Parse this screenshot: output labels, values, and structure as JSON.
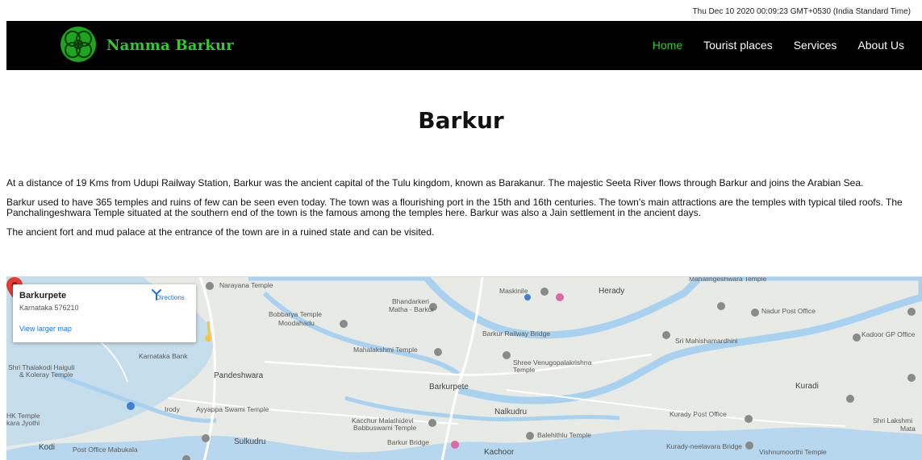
{
  "header": {
    "datetime": "Thu Dec 10 2020 00:09:23 GMT+0530 (India Standard Time)"
  },
  "navbar": {
    "brand": "Namma Barkur",
    "links": [
      {
        "label": "Home",
        "active": true
      },
      {
        "label": "Tourist places",
        "active": false
      },
      {
        "label": "Services",
        "active": false
      },
      {
        "label": "About Us",
        "active": false
      }
    ],
    "accent_color": "#2ecc2e"
  },
  "main": {
    "title": "Barkur",
    "paragraphs": [
      "At a distance of 19 Kms from Udupi Railway Station, Barkur was the ancient capital of the Tulu kingdom, known as Barakanur. The majestic Seeta River flows through Barkur and joins the Arabian Sea.",
      "Barkur used to have 365 temples and ruins of few can be seen even today. The town was a flourishing port in the 15th and 16th centuries. The town's main attractions are the temples with typical tiled roofs. The Panchalingeshwara Temple situated at the southern end of the town is the famous among the temples here. Barkur was also a Jain settlement in the ancient days.",
      "The ancient fort and mud palace at the entrance of the town are in a ruined state and can be visited."
    ]
  },
  "map": {
    "card": {
      "title": "Barkurpete",
      "address": "Karnataka 576210",
      "directions": "Directions",
      "larger_map": "View larger map"
    },
    "labels": {
      "narayana": "Narayana Temple",
      "bobbarya": "Bobbarya Temple",
      "moodahadu": "Moodahadu",
      "bhandarkeri": "Bhandarkeri",
      "matha": "Matha - Barkur",
      "maskinile": "Maskinile",
      "herady": "Herady",
      "nadur": "Nadur Post Office",
      "kadoor": "Kadoor GP Office",
      "railway": "Barkur Railway Bridge",
      "mahalakshmi": "Mahalakshmi Temple",
      "shree": "Shree Venugopalakrishna",
      "temple": "Temple",
      "sri_mahisha": "Sri Mahishamardhini",
      "kurkadi": "Kuradi",
      "karnataka_bank": "Karnataka Bank",
      "shri_thalakodi": "Shri Thalakodi Haiguli",
      "koleray": "& Koleray Temple",
      "pandeshwara": "Pandeshwara",
      "barkurpete": "Barkurpete",
      "irody": "Irody",
      "ayyappa": "Ayyappa Swami Temple",
      "kacchur": "Kacchur Malathidevi",
      "babbuswami": "Babbuswami Temple",
      "nalkudru": "Nalkudru",
      "kurady_post": "Kurady Post Office",
      "shri_lakshmi": "Shri Lakshmi",
      "mata": "Mata",
      "hk_temple": "HK Temple",
      "kara_jyothi": "kara Jyothi",
      "kodi": "Kodi",
      "post_mabukala": "Post Office Mabukala",
      "sulkudru": "Sulkudru",
      "barkur_bridge": "Barkur Bridge",
      "kachoor": "Kachoor",
      "balehithlu": "Balehithlu Temple",
      "kurady_neelavara": "Kurady-neelavara Bridge",
      "vishnumoorthi": "Vishnumoorthi Temple",
      "mahalingeshwara": "Mahalingeshwara Temple"
    },
    "colors": {
      "water": "#a9d2f0",
      "land": "#e8eae6",
      "road": "#ffffff",
      "poi": "#8a8a8a",
      "pin": "#e53935"
    }
  }
}
